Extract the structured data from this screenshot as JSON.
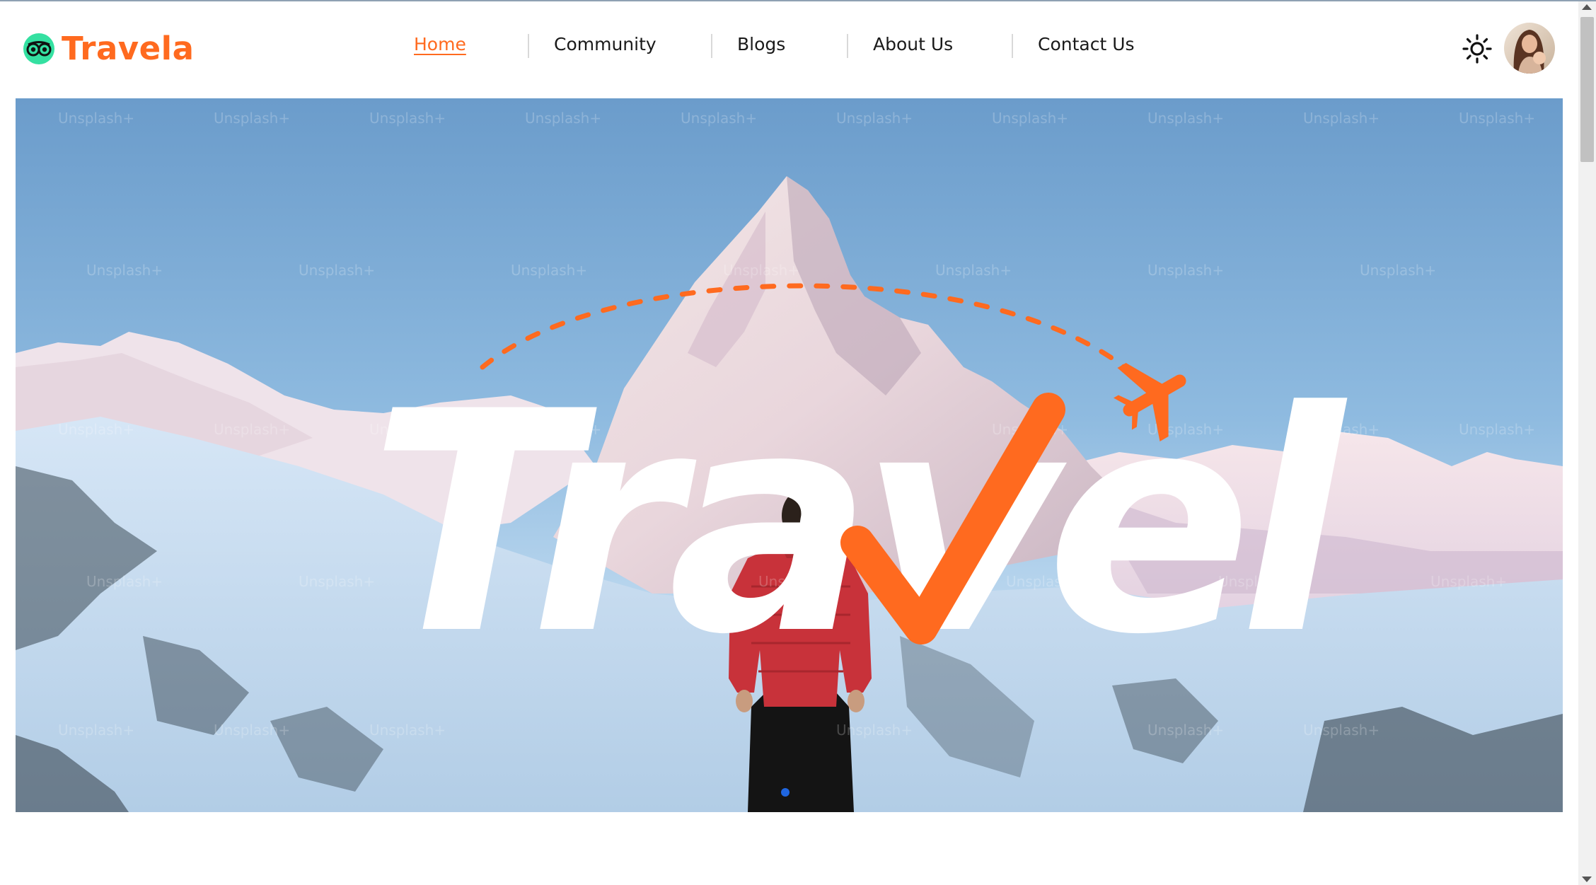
{
  "brand": {
    "name": "Travela",
    "icon": "owl-eyes-icon",
    "color": "#ff6a1f",
    "icon_color": "#34e0a1"
  },
  "nav": {
    "items": [
      {
        "label": "Home",
        "active": true
      },
      {
        "label": "Community",
        "active": false
      },
      {
        "label": "Blogs",
        "active": false
      },
      {
        "label": "About Us",
        "active": false
      },
      {
        "label": "Contact Us",
        "active": false
      }
    ],
    "active_color": "#ff6a1f"
  },
  "header_actions": {
    "theme_toggle_icon": "sun-icon",
    "avatar_icon": "user-avatar"
  },
  "hero": {
    "title": "Travel",
    "title_accent_letter": "v",
    "title_color": "#ffffff",
    "accent_color": "#ff6a1f",
    "decor_icon": "airplane-icon",
    "background": "snowy-mountain-hiker-photo",
    "watermark": "Unsplash+",
    "slide_count": 1,
    "active_slide": 1,
    "dot_color": "#1f66e0"
  }
}
